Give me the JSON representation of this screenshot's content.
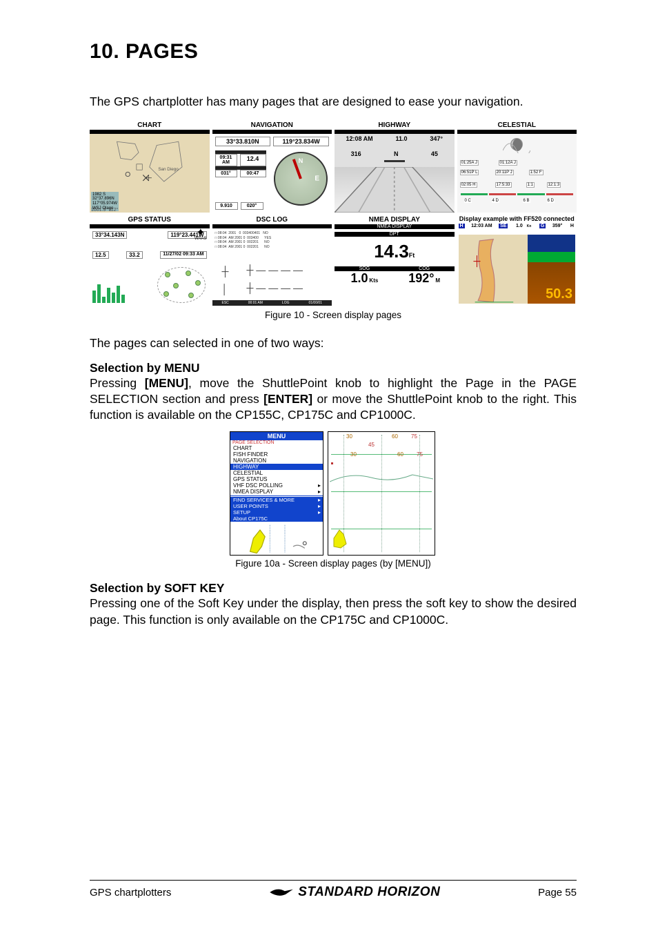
{
  "heading": "10.  PAGES",
  "intro": "The GPS chartplotter has many pages that are designed to ease your navigation.",
  "grid": {
    "row1": [
      "CHART",
      "NAVIGATION",
      "HIGHWAY",
      "CELESTIAL"
    ],
    "row2": [
      "GPS STATUS",
      "DSC LOG",
      "NMEA DISPLAY",
      "Display example with FF520 connected"
    ]
  },
  "chart_thumb": {
    "info1": "1982 S",
    "info2": "32°37.896N",
    "info3": "117°05.974W",
    "info4": "WSJ  Olago",
    "bot1": "1001.9",
    "bot2": "112°",
    "place": "San Diego"
  },
  "nav_thumb": {
    "lat": "33°33.810N",
    "lon": "119°23.834W",
    "time": "09:31 AM",
    "spd": "12.4",
    "brg": "031°",
    "ttg": "00:47",
    "dst": "9.910",
    "cog": "020°"
  },
  "hwy_thumb": {
    "a": "12:08 AM",
    "b": "11.0",
    "c": "347°",
    "d": "316",
    "e": "N",
    "f": "45"
  },
  "cele_thumb": {
    "b1": "01:25A J",
    "b2": "01:12A J",
    "b3": "06:51P L",
    "b4": "20:11P J",
    "b5": "1:52 F",
    "b6": "02:05 H",
    "b7": "17:5:33",
    "b8": "1:1",
    "b9": "12:1:3",
    "c1": "0 C",
    "c2": "4 D",
    "c3": "6 B",
    "c4": "6 D"
  },
  "gps_thumb": {
    "lat": "33°34.143N",
    "lon": "119°23.441W",
    "waas": "WAAS",
    "v1": "12.5",
    "v2": "33.2",
    "dt": "11/27/02 09:33 AM"
  },
  "nmea_thumb": {
    "top": "NMEA DISPLAY",
    "hdr": "DPT",
    "depth": "14.3",
    "depthu": "Ft",
    "sog_lbl": "SOG",
    "cog_lbl": "COG",
    "sog": "1.0",
    "sogu": "Kts",
    "cog": "192°",
    "cogu": "M"
  },
  "ff_thumb": {
    "time": "12:03 AM",
    "u1": "SE",
    "spd": "1.0",
    "spdu": "Kn",
    "brg": "359°",
    "h": "H",
    "depth": "50.3"
  },
  "fig10_cap": "Figure 10 - Screen display pages",
  "after_grid": "The pages can selected in one of two ways:",
  "sel_menu_h": "Selection by MENU",
  "sel_menu_p1a": "Pressing ",
  "sel_menu_b1": "[MENU]",
  "sel_menu_p1b": ", move the ShuttlePoint knob to highlight the Page in the PAGE SELECTION section and press ",
  "sel_menu_b2": "[ENTER]",
  "sel_menu_p1c": " or move the ShuttlePoint knob to the right. This function is available on the CP155C, CP175C and CP1000C.",
  "menu_fig": {
    "title": "MENU",
    "sec": "PAGE SELECTION",
    "items": [
      "CHART",
      "FISH FINDER",
      "NAVIGATION",
      "HIGHWAY",
      "CELESTIAL",
      "GPS STATUS",
      "VHF DSC POLLING",
      "NMEA DISPLAY"
    ],
    "hl_index": 3,
    "caret_indices": [
      6,
      7
    ],
    "foot1": "FIND SERVICES & MORE",
    "foot2": "USER POINTS",
    "foot3": "SETUP",
    "foot4": "About CP175C",
    "foot_caret": [
      true,
      true,
      true,
      false
    ],
    "sonar": {
      "t30a": "30",
      "t60": "60",
      "t75": "75",
      "t45": "45",
      "m30": "30",
      "m60": "60",
      "m75": "75"
    }
  },
  "fig10a_cap": "Figure 10a - Screen display pages (by [MENU])",
  "sel_soft_h": "Selection by SOFT KEY",
  "sel_soft_p": "Pressing one of the Soft Key under the display, then press the soft key to show the desired page. This function is only available on the CP175C and CP1000C.",
  "footer": {
    "left": "GPS chartplotters",
    "brand": "STANDARD HORIZON",
    "right": "Page 55"
  }
}
